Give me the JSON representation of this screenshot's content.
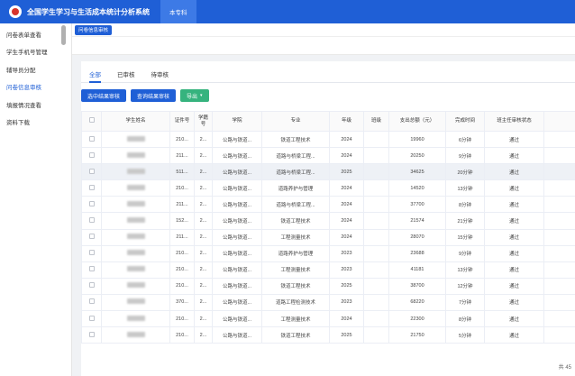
{
  "header": {
    "title": "全国学生学习与生活成本统计分析系统",
    "active_tab": "本专科"
  },
  "sidebar": {
    "items": [
      {
        "label": "问卷表单查看",
        "active": false
      },
      {
        "label": "学生手机号管理",
        "active": false
      },
      {
        "label": "辅导员分配",
        "active": false
      },
      {
        "label": "问卷信息审核",
        "active": true
      },
      {
        "label": "填报情况查看",
        "active": false
      },
      {
        "label": "资料下载",
        "active": false
      }
    ]
  },
  "breadcrumb": {
    "tag": "问卷信息审核"
  },
  "tabs": [
    {
      "label": "全部",
      "active": true
    },
    {
      "label": "已审核",
      "active": false
    },
    {
      "label": "待审核",
      "active": false
    }
  ],
  "toolbar": {
    "review_selected": "选中结果审核",
    "review_query": "查询结果审核",
    "export": "导出"
  },
  "table": {
    "headers": [
      "学生姓名",
      "证件号",
      "学籍号",
      "学院",
      "专业",
      "年级",
      "班级",
      "支出总额（元）",
      "完成时间",
      "班主任审核状态"
    ],
    "rows": [
      {
        "id": "210...",
        "xj": "2...",
        "college": "公路与铁道...",
        "major": "铁道工程技术",
        "grade": "2024",
        "class": "",
        "total": "19960",
        "time": "6分钟",
        "status": "通过"
      },
      {
        "id": "211...",
        "xj": "2...",
        "college": "公路与铁道...",
        "major": "道路与桥梁工程...",
        "grade": "2024",
        "class": "",
        "total": "20250",
        "time": "9分钟",
        "status": "通过"
      },
      {
        "id": "511...",
        "xj": "2...",
        "college": "公路与铁道...",
        "major": "道路与桥梁工程...",
        "grade": "2025",
        "class": "",
        "total": "34625",
        "time": "20分钟",
        "status": "通过"
      },
      {
        "id": "210...",
        "xj": "2...",
        "college": "公路与铁道...",
        "major": "道路养护与管理",
        "grade": "2024",
        "class": "",
        "total": "14520",
        "time": "13分钟",
        "status": "通过"
      },
      {
        "id": "211...",
        "xj": "2...",
        "college": "公路与铁道...",
        "major": "道路与桥梁工程...",
        "grade": "2024",
        "class": "",
        "total": "37700",
        "time": "8分钟",
        "status": "通过"
      },
      {
        "id": "152...",
        "xj": "2...",
        "college": "公路与铁道...",
        "major": "铁道工程技术",
        "grade": "2024",
        "class": "",
        "total": "21574",
        "time": "21分钟",
        "status": "通过"
      },
      {
        "id": "211...",
        "xj": "2...",
        "college": "公路与铁道...",
        "major": "工程测量技术",
        "grade": "2024",
        "class": "",
        "total": "28070",
        "time": "15分钟",
        "status": "通过"
      },
      {
        "id": "210...",
        "xj": "2...",
        "college": "公路与铁道...",
        "major": "道路养护与管理",
        "grade": "2023",
        "class": "",
        "total": "23688",
        "time": "9分钟",
        "status": "通过"
      },
      {
        "id": "210...",
        "xj": "2...",
        "college": "公路与铁道...",
        "major": "工程测量技术",
        "grade": "2023",
        "class": "",
        "total": "41181",
        "time": "13分钟",
        "status": "通过"
      },
      {
        "id": "210...",
        "xj": "2...",
        "college": "公路与铁道...",
        "major": "铁道工程技术",
        "grade": "2025",
        "class": "",
        "total": "38700",
        "time": "12分钟",
        "status": "通过"
      },
      {
        "id": "370...",
        "xj": "2...",
        "college": "公路与铁道...",
        "major": "道路工程检测技术",
        "grade": "2023",
        "class": "",
        "total": "68220",
        "time": "7分钟",
        "status": "通过"
      },
      {
        "id": "210...",
        "xj": "2...",
        "college": "公路与铁道...",
        "major": "工程测量技术",
        "grade": "2024",
        "class": "",
        "total": "22300",
        "time": "8分钟",
        "status": "通过"
      },
      {
        "id": "210...",
        "xj": "2...",
        "college": "公路与铁道...",
        "major": "铁道工程技术",
        "grade": "2025",
        "class": "",
        "total": "21750",
        "time": "5分钟",
        "status": "通过"
      }
    ]
  },
  "pagination": {
    "total": "共 45"
  }
}
